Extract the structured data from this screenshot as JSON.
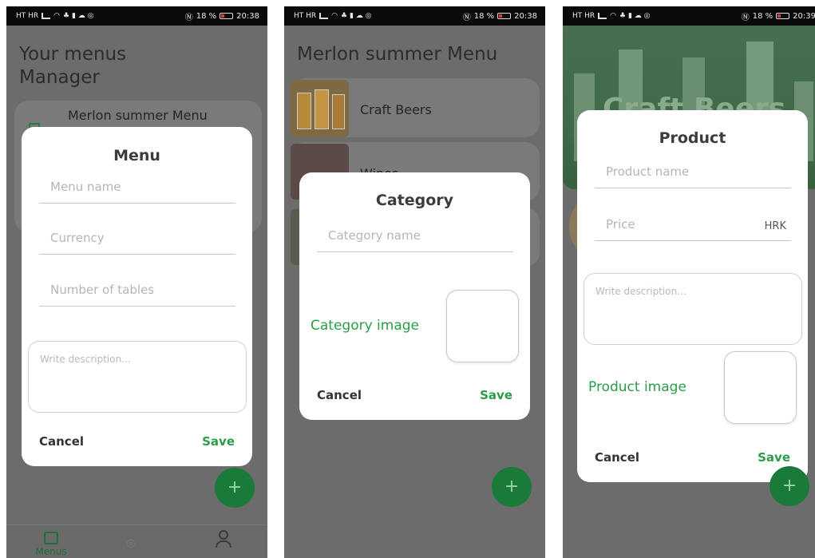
{
  "status_bars": {
    "p1": {
      "carrier": "HT HR",
      "battery": "18 %",
      "time": "20:38"
    },
    "p2": {
      "carrier": "HT HR",
      "battery": "18 %",
      "time": "20:38"
    },
    "p3": {
      "carrier": "HT HR",
      "battery": "18 %",
      "time": "20:39"
    }
  },
  "screen1": {
    "title_line1": "Your menus",
    "title_line2": "Manager",
    "bg_menu_name": "Merlon summer Menu",
    "dialog": {
      "title": "Menu",
      "menu_name_placeholder": "Menu name",
      "currency_placeholder": "Currency",
      "tables_placeholder": "Number of tables",
      "description_placeholder": "Write description...",
      "cancel": "Cancel",
      "save": "Save"
    },
    "fab": "+",
    "nav": {
      "menus": "Menus"
    }
  },
  "screen2": {
    "title": "Merlon summer Menu",
    "bg_categories": [
      "Craft Beers",
      "Wines"
    ],
    "dialog": {
      "title": "Category",
      "category_name_placeholder": "Category name",
      "image_label": "Category image",
      "cancel": "Cancel",
      "save": "Save"
    },
    "fab": "+"
  },
  "screen3": {
    "bg_header_text": "Craft Beers",
    "dialog": {
      "title": "Product",
      "product_name_placeholder": "Product name",
      "price_placeholder": "Price",
      "currency_suffix": "HRK",
      "description_placeholder": "Write description...",
      "image_label": "Product image",
      "cancel": "Cancel",
      "save": "Save"
    },
    "fab": "+"
  },
  "colors": {
    "accent_green": "#2a9d48",
    "fab_green": "#1a7a3a",
    "dim_overlay": "#6c6c6c"
  }
}
